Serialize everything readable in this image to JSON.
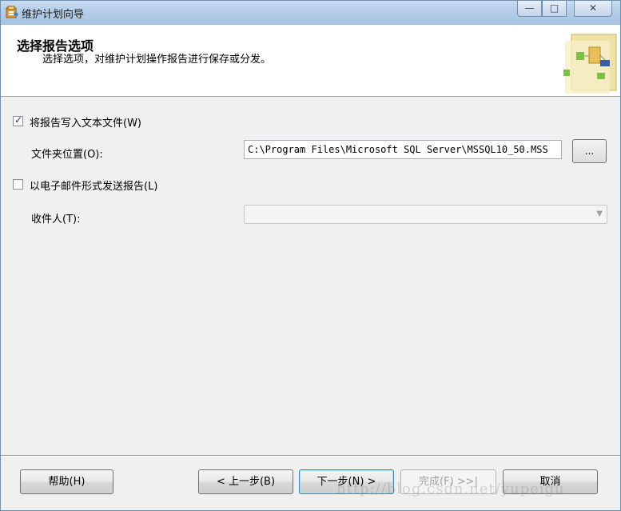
{
  "window": {
    "title": "维护计划向导",
    "controls": {
      "minimize": "—",
      "maximize": "□",
      "close": "✕"
    }
  },
  "header": {
    "title": "选择报告选项",
    "subtitle": "选择选项，对维护计划操作报告进行保存或分发。",
    "graphic_icon": "wizard-graphic-icon"
  },
  "form": {
    "write_to_file": {
      "label": "将报告写入文本文件(W)",
      "checked": true
    },
    "folder_location": {
      "label": "文件夹位置(O):",
      "value": "C:\\Program Files\\Microsoft SQL Server\\MSSQL10_50.MSS",
      "browse_label": "..."
    },
    "send_email": {
      "label": "以电子邮件形式发送报告(L)",
      "checked": false
    },
    "recipient": {
      "label": "收件人(T):",
      "value": "",
      "enabled": false
    }
  },
  "footer": {
    "help": "帮助(H)",
    "back": "< 上一步(B)",
    "next": "下一步(N) >",
    "finish": "完成(F) >>|",
    "cancel": "取消"
  },
  "watermark": "http://blog.csdn.net/yupeigu",
  "colors": {
    "titlebar": "#b4cde8",
    "header_bg": "#ffffff",
    "body_bg": "#f0f0f0",
    "check_mark": "#1d3e76"
  }
}
